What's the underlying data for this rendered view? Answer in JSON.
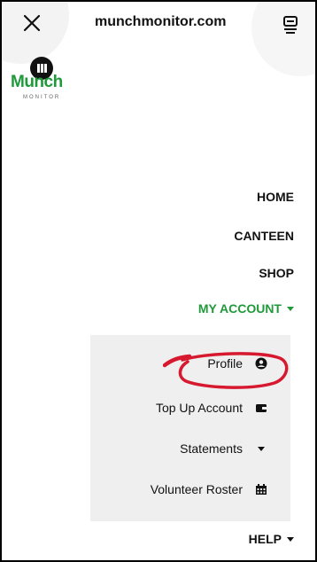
{
  "browser": {
    "url": "munchmonitor.com",
    "close_icon": "close-icon",
    "tabs_icon": "tabs-icon"
  },
  "logo": {
    "word": "Munch",
    "subtitle": "MONITOR"
  },
  "nav": {
    "home": "HOME",
    "canteen": "CANTEEN",
    "shop": "SHOP",
    "my_account": "MY ACCOUNT",
    "help": "HELP"
  },
  "submenu": {
    "profile": "Profile",
    "top_up": "Top Up Account",
    "statements": "Statements",
    "volunteer_roster": "Volunteer Roster"
  },
  "colors": {
    "accent_green": "#1f9a3a",
    "highlight_red": "#d7192f",
    "submenu_bg": "#efefef"
  }
}
